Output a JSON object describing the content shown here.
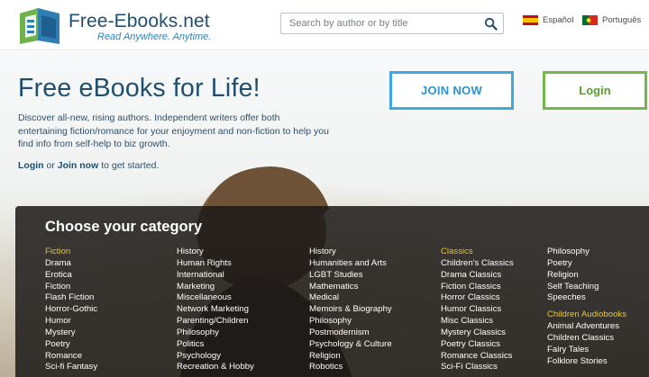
{
  "header": {
    "brand": "Free-Ebooks.net",
    "tagline": "Read Anywhere. Anytime.",
    "search_placeholder": "Search by author or by title",
    "languages": [
      {
        "label": "Español",
        "icon": "spain-flag-icon"
      },
      {
        "label": "Português",
        "icon": "portugal-flag-icon"
      }
    ]
  },
  "hero": {
    "title": "Free eBooks for Life!",
    "description": "Discover all-new, rising authors. Independent writers offer both entertaining fiction/romance for your enjoyment and non-fiction to help you find info from self-help to biz growth.",
    "cta_login": "Login",
    "cta_or": "or",
    "cta_join": "Join now",
    "cta_rest": "to get started.",
    "join_button": "JOIN NOW",
    "login_button": "Login"
  },
  "categories": {
    "title": "Choose your category",
    "col1": [
      "Fiction",
      "Drama",
      "Erotica",
      "Fiction",
      "Flash Fiction",
      "Horror-Gothic",
      "Humor",
      "Mystery",
      "Poetry",
      "Romance",
      "Sci-fi Fantasy"
    ],
    "col2": [
      "History",
      "Human Rights",
      "International",
      "Marketing",
      "Miscellaneous",
      "Network Marketing",
      "Parenting/Children",
      "Philosophy",
      "Politics",
      "Psychology",
      "Recreation & Hobby"
    ],
    "col3": [
      "History",
      "Humanities and Arts",
      "LGBT Studies",
      "Mathematics",
      "Medical",
      "Memoirs & Biography",
      "Philosophy",
      "Postmodernism",
      "Psychology & Culture",
      "Religion",
      "Robotics"
    ],
    "col4": [
      "Classics",
      "Children's Classics",
      "Drama Classics",
      "Fiction Classics",
      "Horror Classics",
      "Humor Classics",
      "Misc Classics",
      "Mystery Classics",
      "Poetry Classics",
      "Romance Classics",
      "Sci-Fi Classics"
    ],
    "col5": [
      "Philosophy",
      "Poetry",
      "Religion",
      "Self Teaching",
      "Speeches",
      "",
      "Children Audiobooks",
      "Animal Adventures",
      "Children Classics",
      "Fairy Tales",
      "Folklore Stories"
    ]
  },
  "colors": {
    "brand_blue": "#1f4f70",
    "join_blue": "#3fa9df",
    "login_green": "#74b84b",
    "category_heading": "#e6c637"
  }
}
